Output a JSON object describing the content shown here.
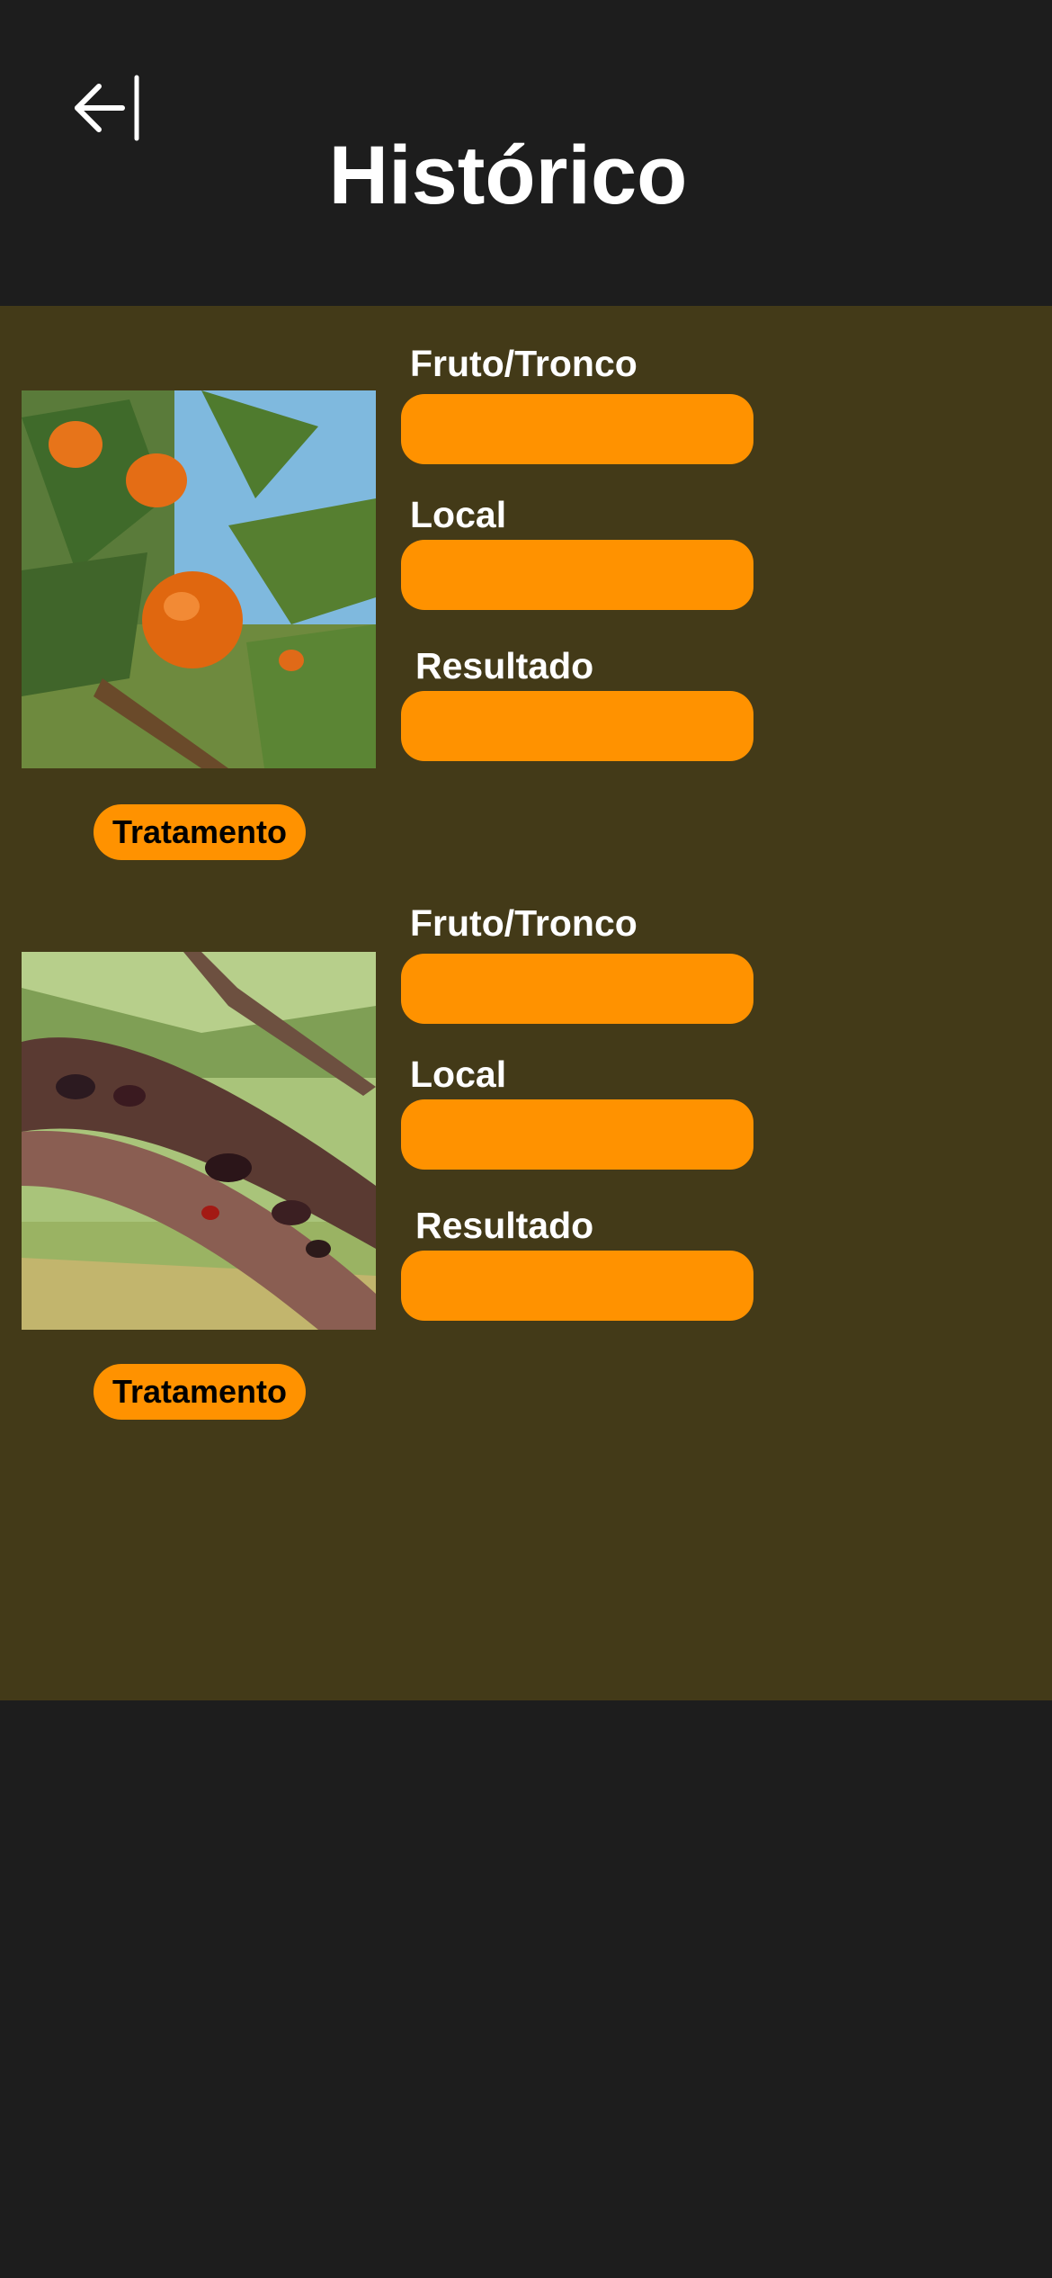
{
  "header": {
    "back_icon": "back-arrow-icon",
    "title": "Histórico"
  },
  "colors": {
    "background": "#1d1d1d",
    "content_background": "#433a18",
    "accent": "#ff9200",
    "text": "#ffffff",
    "button_text": "#000000"
  },
  "records": [
    {
      "photo": "orange-fruit-tree-photo",
      "fields": [
        {
          "label": "Fruto/Tronco",
          "value": ""
        },
        {
          "label": "Local",
          "value": ""
        },
        {
          "label": "Resultado",
          "value": ""
        }
      ],
      "action_label": "Tratamento"
    },
    {
      "photo": "diseased-trunk-photo",
      "fields": [
        {
          "label": "Fruto/Tronco",
          "value": ""
        },
        {
          "label": "Local",
          "value": ""
        },
        {
          "label": "Resultado",
          "value": ""
        }
      ],
      "action_label": "Tratamento"
    }
  ]
}
